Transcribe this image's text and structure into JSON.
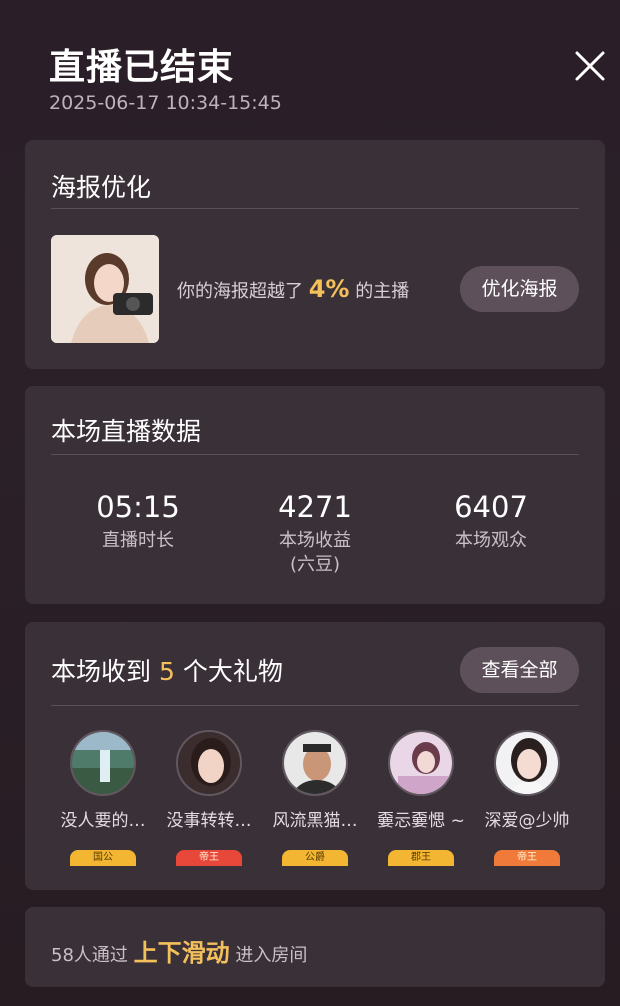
{
  "header": {
    "title": "直播已结束",
    "subtitle": "2025-06-17 10:34-15:45"
  },
  "poster": {
    "heading": "海报优化",
    "text_before": "你的海报超越了",
    "percent": "4%",
    "text_after": "的主播",
    "button_label": "优化海报"
  },
  "stats": {
    "heading": "本场直播数据",
    "items": [
      {
        "value": "05:15",
        "label": "直播时长",
        "label2": ""
      },
      {
        "value": "4271",
        "label": "本场收益",
        "label2": "(六豆)"
      },
      {
        "value": "6407",
        "label": "本场观众",
        "label2": ""
      }
    ]
  },
  "gifts": {
    "heading_before": "本场收到",
    "count": "5",
    "heading_after": "个大礼物",
    "view_all_label": "查看全部",
    "items": [
      {
        "name": "没人要的…",
        "badge": "国公",
        "badge_color": "#f2b632"
      },
      {
        "name": "没事转转…",
        "badge": "帝王",
        "badge_color": "#e8483a"
      },
      {
        "name": "风流黑猫…",
        "badge": "公爵",
        "badge_color": "#f2b632"
      },
      {
        "name": "嫑忈嫑愢 ~",
        "badge": "郡王",
        "badge_color": "#f2b632"
      },
      {
        "name": "深爱@少帅",
        "badge": "帝王",
        "badge_color": "#f07a3a"
      }
    ]
  },
  "enter": {
    "text_before": "58人通过",
    "highlight": "上下滑动",
    "text_after": "进入房间"
  },
  "colors": {
    "accent": "#f3c05b",
    "card_bg": "#3a3038",
    "page_bg": "#2a1f29"
  }
}
